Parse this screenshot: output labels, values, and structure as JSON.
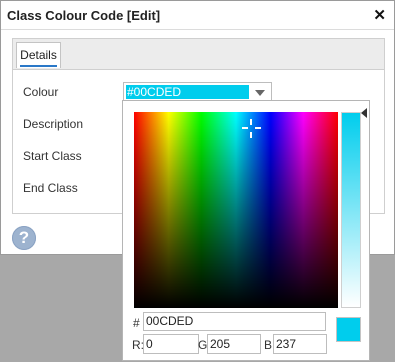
{
  "window": {
    "title": "Class Colour Code [Edit]",
    "close_glyph": "✕"
  },
  "tabs": [
    {
      "label": "Details"
    }
  ],
  "form": {
    "colour_label": "Colour",
    "description_label": "Description",
    "start_class_label": "Start Class",
    "end_class_label": "End Class",
    "colour_value": "#00CDED"
  },
  "help": {
    "glyph": "?",
    "icon": "help-icon"
  },
  "picker": {
    "hash_label": "#",
    "hex_value": "00CDED",
    "r_label": "R:",
    "r_value": "0",
    "g_label": "G:",
    "g_value": "205",
    "b_label": "B:",
    "b_value": "237",
    "selected_color": "#00cded"
  },
  "colors": {
    "selected": "#00cded",
    "page_backdrop": "#a8a8a8",
    "tab_underline": "#2a78c8"
  }
}
